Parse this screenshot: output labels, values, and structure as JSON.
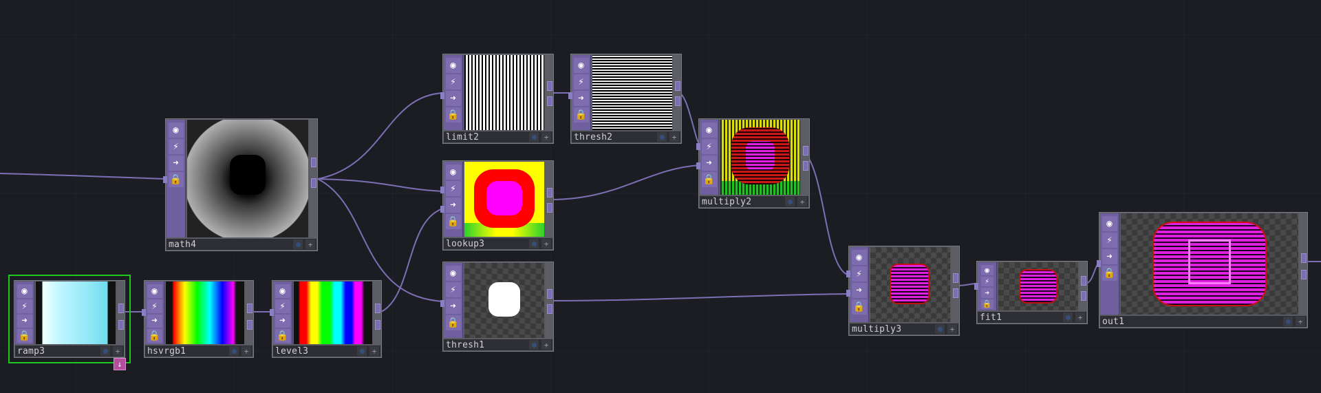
{
  "nodes": {
    "ramp3": {
      "name": "ramp3"
    },
    "hsvrgb1": {
      "name": "hsvrgb1"
    },
    "level3": {
      "name": "level3"
    },
    "math4": {
      "name": "math4"
    },
    "limit2": {
      "name": "limit2"
    },
    "lookup3": {
      "name": "lookup3"
    },
    "thresh1": {
      "name": "thresh1"
    },
    "thresh2": {
      "name": "thresh2"
    },
    "multiply2": {
      "name": "multiply2"
    },
    "multiply3": {
      "name": "multiply3"
    },
    "fit1": {
      "name": "fit1"
    },
    "out1": {
      "name": "out1"
    }
  },
  "icons": {
    "viewer": "◉",
    "bypass": "⚡",
    "clone": "➜",
    "lock": "🔒",
    "plus": "+"
  },
  "colors": {
    "background": "#1b1d22",
    "wire": "#8c7fd0",
    "selection": "#1ec81e",
    "operator_strip": "#6f5f9e"
  }
}
